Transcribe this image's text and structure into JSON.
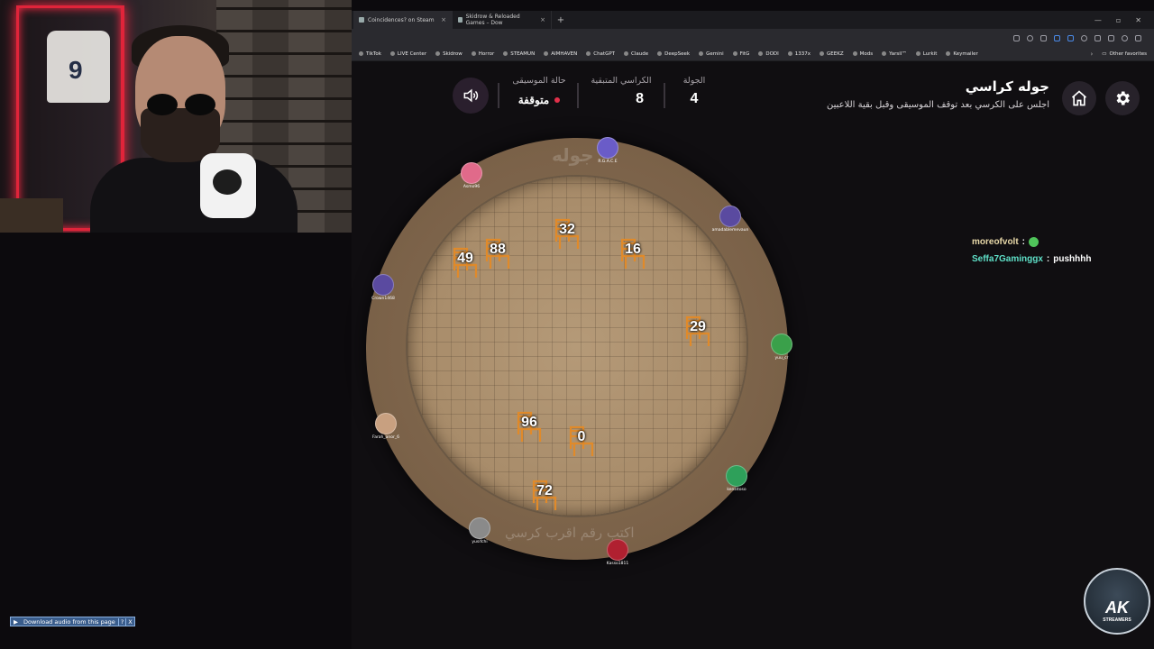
{
  "browser": {
    "tabs": [
      {
        "label": "Coincidences? on Steam"
      },
      {
        "label": "Skidrow & Reloaded Games – Dow"
      }
    ],
    "bookmarks": [
      "TikTok",
      "LIVE Center",
      "Skidrow",
      "Horror",
      "STEAMUN",
      "AIMHAVEN",
      "ChatGPT",
      "Claude",
      "DeepSeek",
      "Gemini",
      "FitG",
      "DODI",
      "1337x",
      "GEEKZ",
      "Mods",
      "Yarsil™",
      "Lurkit",
      "Keymailer"
    ],
    "other_favorites": "Other favorites"
  },
  "webcam": {
    "jersey_number": "9"
  },
  "game": {
    "title": "جوله كراسي",
    "subtitle": "اجلس على الكرسي بعد توقف الموسيقى وقبل بقية اللاعبين",
    "stats": {
      "round_label": "الجولة",
      "round_value": "4",
      "chairs_label": "الكراسي المتبقية",
      "chairs_value": "8",
      "music_label": "حالة الموسيقى",
      "music_value": "متوقفة"
    },
    "board_round_label": "جوله",
    "board_hint": "اكتب رقم اقرب كرسي",
    "chairs": [
      "32",
      "88",
      "49",
      "16",
      "29",
      "96",
      "0",
      "72"
    ],
    "players": [
      {
        "name": "R.G.A.C.E",
        "color": "#6a5cc8"
      },
      {
        "name": "Asmo96",
        "color": "#e06a8a"
      },
      {
        "name": "amadablemevaun",
        "color": "#5a4aa0"
      },
      {
        "name": "Crown1468",
        "color": "#5a4aa0"
      },
      {
        "name": "yuu_cr",
        "color": "#3aa04a"
      },
      {
        "name": "Farah_anor_6",
        "color": "#c8a080"
      },
      {
        "name": "kenzitoso",
        "color": "#2ea05a"
      },
      {
        "name": "yusifchi",
        "color": "#8a8a8a"
      },
      {
        "name": "Kasso1811",
        "color": "#b02030"
      }
    ]
  },
  "chat": [
    {
      "user": "moreofvolt",
      "message": ""
    },
    {
      "user": "Seffa7Gaminggx",
      "message": "pushhhh"
    }
  ],
  "overlay": {
    "download_label": "Download audio from this page",
    "download_help": "?",
    "download_close": "X",
    "logo_text": "AK",
    "logo_sub": "STREAMERS"
  },
  "colors": {
    "accent_red": "#e2304a",
    "chair_orange": "#e08a2a",
    "chat_teal": "#5fe0c8"
  }
}
